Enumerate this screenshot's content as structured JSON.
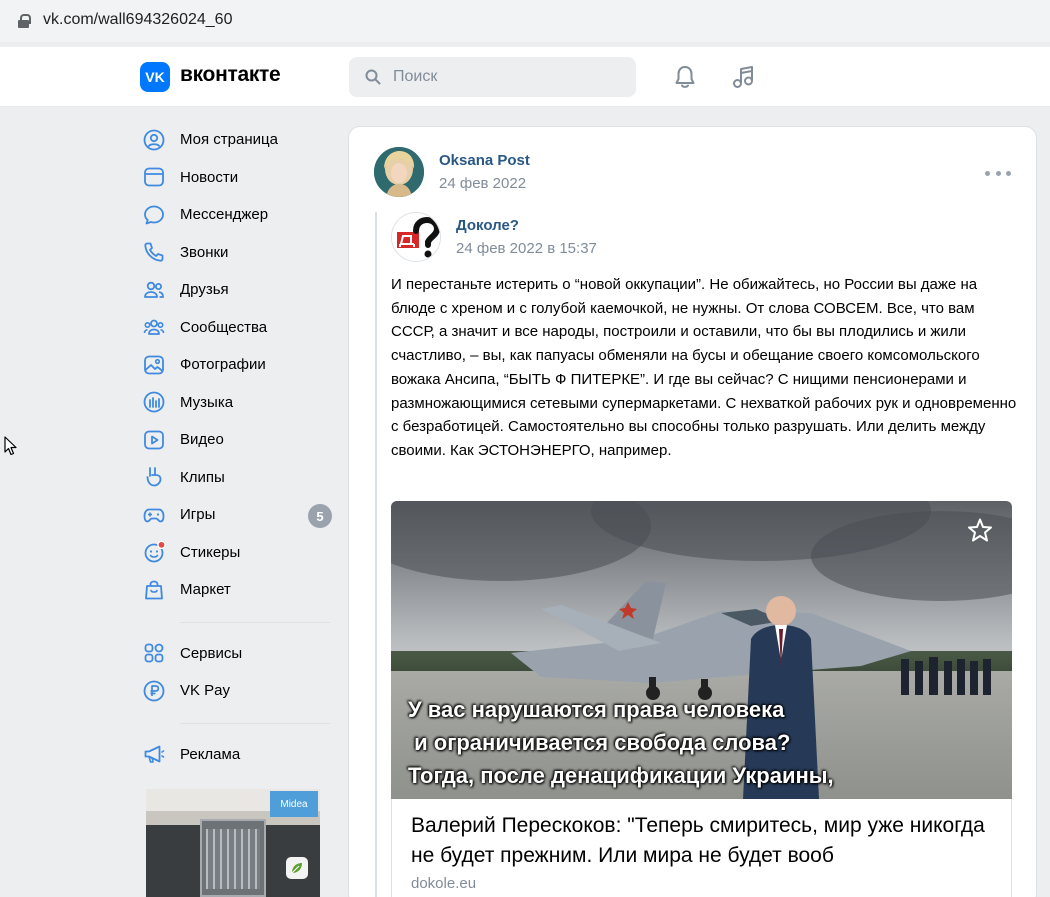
{
  "browser": {
    "url": "vk.com/wall694326024_60"
  },
  "header": {
    "logo_mark": "VK",
    "logo_text": "вконтакте",
    "search_placeholder": "Поиск"
  },
  "sidebar": {
    "items": [
      {
        "label": "Моя страница",
        "icon": "user-circle-icon"
      },
      {
        "label": "Новости",
        "icon": "news-icon"
      },
      {
        "label": "Мессенджер",
        "icon": "message-icon"
      },
      {
        "label": "Звонки",
        "icon": "phone-icon"
      },
      {
        "label": "Друзья",
        "icon": "friends-icon"
      },
      {
        "label": "Сообщества",
        "icon": "communities-icon"
      },
      {
        "label": "Фотографии",
        "icon": "photo-icon"
      },
      {
        "label": "Музыка",
        "icon": "music-icon"
      },
      {
        "label": "Видео",
        "icon": "video-icon"
      },
      {
        "label": "Клипы",
        "icon": "clips-icon"
      },
      {
        "label": "Игры",
        "icon": "games-icon",
        "badge": "5"
      },
      {
        "label": "Стикеры",
        "icon": "stickers-icon"
      },
      {
        "label": "Маркет",
        "icon": "market-icon"
      }
    ],
    "secondary": [
      {
        "label": "Сервисы",
        "icon": "services-icon"
      },
      {
        "label": "VK Pay",
        "icon": "vkpay-icon"
      }
    ],
    "ads": {
      "label": "Реклама",
      "icon": "megaphone-icon"
    },
    "banner_brand": "Midea"
  },
  "post": {
    "author": "Oksana Post",
    "date": "24 фев 2022",
    "repost": {
      "author": "Доколе?",
      "date": "24 фев 2022 в 15:37",
      "text": "И перестаньте истерить о “новой оккупации”. Не обижайтесь, но России вы даже на блюде с хреном и с голубой каемочкой, не нужны. От слова СОВСЕМ. Все, что вам СССР, а значит и все народы, построили и оставили, что бы вы плодились и жили счастливо, – вы, как папуасы обменяли на бусы и обещание своего комсомольского вожака Ансипа, “БЫТЬ Ф ПИТЕРКЕ”. И где вы сейчас? С нищими пенсионерами и размножающимися сетевыми супермаркетами. С нехваткой рабочих рук и одновременно с безработицей. Самостоятельно вы способны только разрушать. Или делить между своими. Как ЭСТОНЭНЕРГО, например.",
      "image_caption": [
        "У вас нарушаются права человека",
        " и ограничивается свобода слова?",
        "Тогда, после денацификации Украины,"
      ],
      "link": {
        "title": "Валерий Перескоков: \"Теперь смиритесь, мир уже никогда не будет прежним. Или мира не будет вооб",
        "source": "dokole.eu"
      }
    }
  },
  "colors": {
    "accent": "#0077ff",
    "link": "#2a5885",
    "muted": "#818c99",
    "badge": "#99a2ad"
  }
}
